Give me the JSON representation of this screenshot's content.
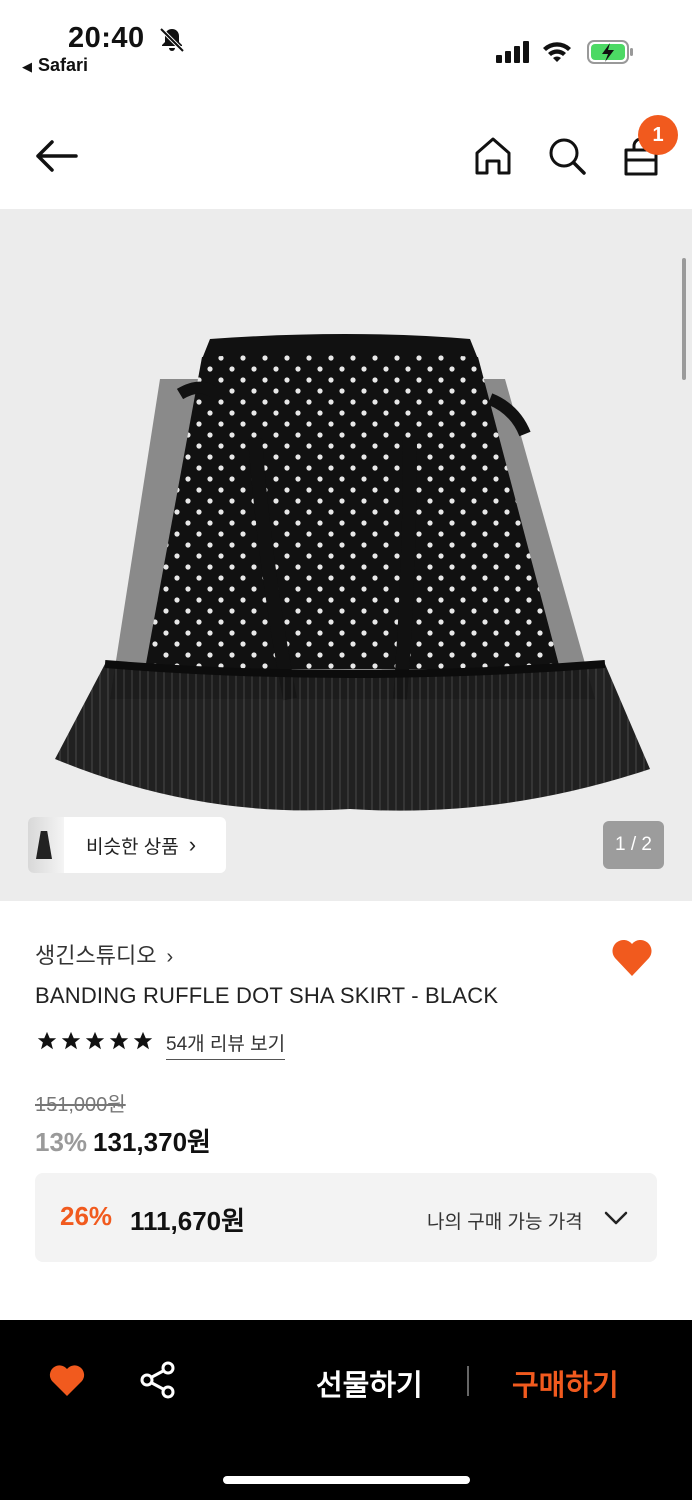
{
  "status": {
    "time": "20:40",
    "back_app": "Safari"
  },
  "nav": {
    "cart_count": "1"
  },
  "gallery": {
    "similar_label": "비슷한 상품",
    "page_indicator": "1 / 2"
  },
  "product": {
    "brand": "생긴스튜디오",
    "name": "BANDING RUFFLE DOT SHA SKIRT - BLACK",
    "rating": 5,
    "reviews_label": "54개 리뷰 보기",
    "original_price": "151,000원",
    "discount": "13%",
    "sale_price": "131,370원"
  },
  "my_price": {
    "discount": "26%",
    "price": "111,670원",
    "label": "나의 구매 가능 가격"
  },
  "bottom": {
    "gift_label": "선물하기",
    "buy_label": "구매하기"
  },
  "colors": {
    "accent": "#f15a1e",
    "bar": "#000000"
  }
}
